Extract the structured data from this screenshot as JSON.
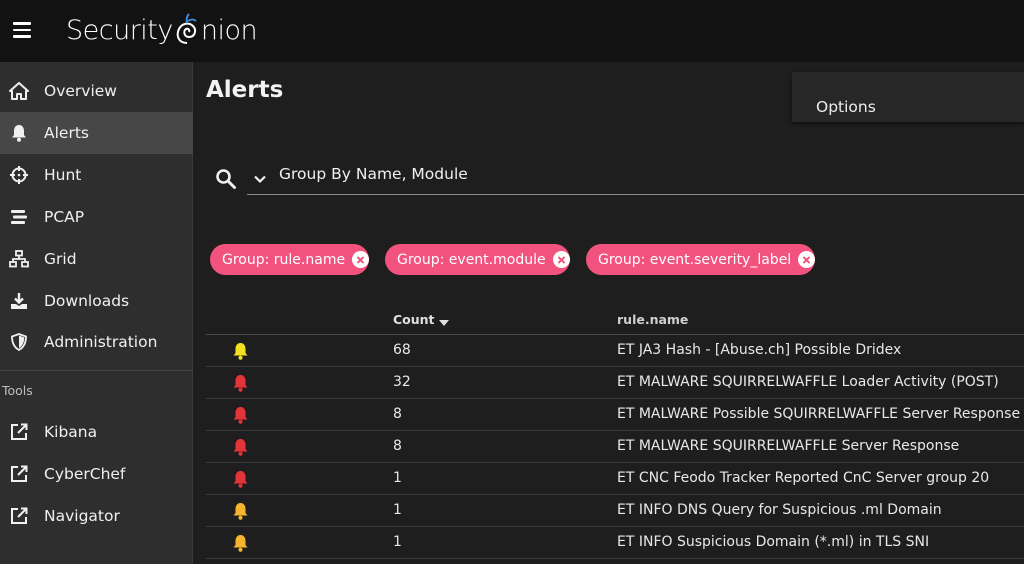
{
  "app": {
    "brand": "Security Onion",
    "brand_left": "Security",
    "brand_right": "nion"
  },
  "sidebar": {
    "items": [
      {
        "label": "Overview",
        "icon": "home-icon"
      },
      {
        "label": "Alerts",
        "icon": "bell-icon",
        "active": true
      },
      {
        "label": "Hunt",
        "icon": "crosshairs-icon"
      },
      {
        "label": "PCAP",
        "icon": "stream-icon"
      },
      {
        "label": "Grid",
        "icon": "sitemap-icon"
      },
      {
        "label": "Downloads",
        "icon": "download-icon"
      },
      {
        "label": "Administration",
        "icon": "shield-icon"
      }
    ],
    "tools_header": "Tools",
    "tools": [
      {
        "label": "Kibana",
        "icon": "external-link-icon"
      },
      {
        "label": "CyberChef",
        "icon": "external-link-icon"
      },
      {
        "label": "Navigator",
        "icon": "external-link-icon"
      }
    ]
  },
  "main": {
    "title": "Alerts",
    "options_label": "Options",
    "query": "Group By Name, Module",
    "chips": [
      {
        "label": "Group: rule.name"
      },
      {
        "label": "Group: event.module"
      },
      {
        "label": "Group: event.severity_label"
      }
    ],
    "table": {
      "columns": {
        "count": "Count",
        "rule": "rule.name"
      },
      "rows": [
        {
          "severity_color": "#f4e11e",
          "count": "68",
          "rule": "ET JA3 Hash - [Abuse.ch] Possible Dridex"
        },
        {
          "severity_color": "#e5333a",
          "count": "32",
          "rule": "ET MALWARE SQUIRRELWAFFLE Loader Activity (POST)"
        },
        {
          "severity_color": "#e5333a",
          "count": "8",
          "rule": "ET MALWARE Possible SQUIRRELWAFFLE Server Response"
        },
        {
          "severity_color": "#e5333a",
          "count": "8",
          "rule": "ET MALWARE SQUIRRELWAFFLE Server Response"
        },
        {
          "severity_color": "#e5333a",
          "count": "1",
          "rule": "ET CNC Feodo Tracker Reported CnC Server group 20"
        },
        {
          "severity_color": "#f7b52c",
          "count": "1",
          "rule": "ET INFO DNS Query for Suspicious .ml Domain"
        },
        {
          "severity_color": "#f7b52c",
          "count": "1",
          "rule": "ET INFO Suspicious Domain (*.ml) in TLS SNI"
        }
      ]
    }
  },
  "colors": {
    "accent_chip": "#f2527e",
    "topbar": "#121212",
    "sidebar": "#2e2e2e",
    "sidebar_active": "#474747",
    "background": "#1e1e1e"
  }
}
